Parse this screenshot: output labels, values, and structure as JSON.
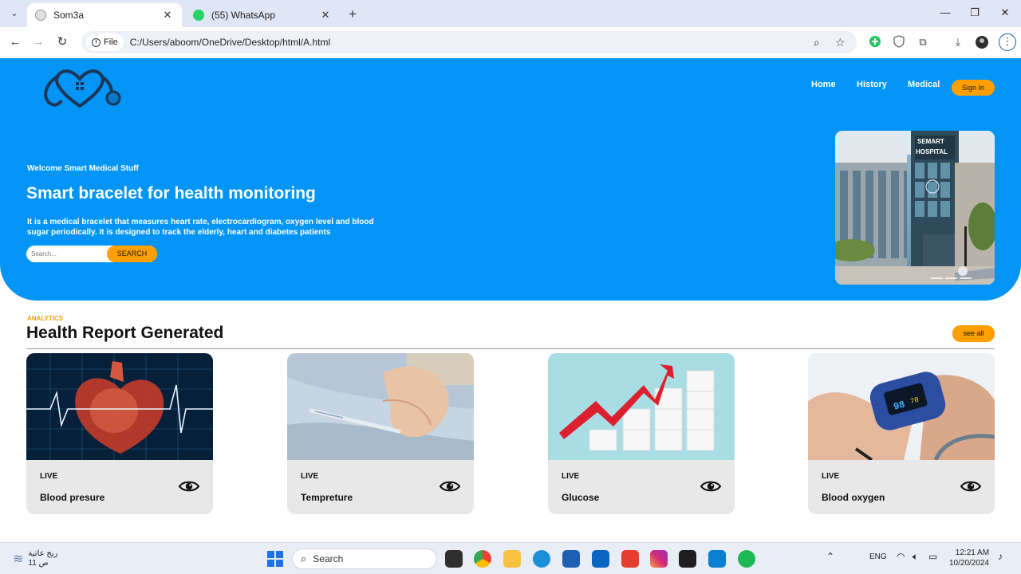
{
  "browser": {
    "tabs": [
      {
        "title": "Som3a",
        "close": "✕"
      },
      {
        "title": "(55) WhatsApp",
        "close": "✕"
      }
    ],
    "new_tab": "+",
    "address": {
      "scheme_chip": "File",
      "url": "C:/Users/aboom/OneDrive/Desktop/html/A.html"
    }
  },
  "site": {
    "nav": {
      "home": "Home",
      "history": "History",
      "medical": "Medical",
      "signin": "Sign In"
    },
    "hero": {
      "welcome": "Welcome Smart Medical Stuff",
      "headline": "Smart bracelet for health monitoring",
      "description": "It is a medical bracelet that measures heart rate, electrocardiogram, oxygen level and blood sugar periodically. It is designed to track the elderly, heart and diabetes patients",
      "search_placeholder": "Search...",
      "search_button": "SEARCH",
      "hospital_sign": [
        "SEMART",
        "HOSPITAL"
      ]
    },
    "report": {
      "eyebrow": "ANALYTICS",
      "title": "Health Report Generated",
      "see_all": "see all",
      "cards": [
        {
          "badge": "LIVE",
          "name": "Blood presure"
        },
        {
          "badge": "LIVE",
          "name": "Tempreture"
        },
        {
          "badge": "LIVE",
          "name": "Glucose"
        },
        {
          "badge": "LIVE",
          "name": "Blood oxygen"
        }
      ]
    },
    "colors": {
      "hero_blue": "#0395f5",
      "accent_orange": "#ff9f00"
    }
  },
  "taskbar": {
    "weather": {
      "line1": "ريح عاتية",
      "line2": "11 ص"
    },
    "search": "Search",
    "language": "ENG",
    "time": "12:21 AM",
    "date": "10/20/2024"
  }
}
